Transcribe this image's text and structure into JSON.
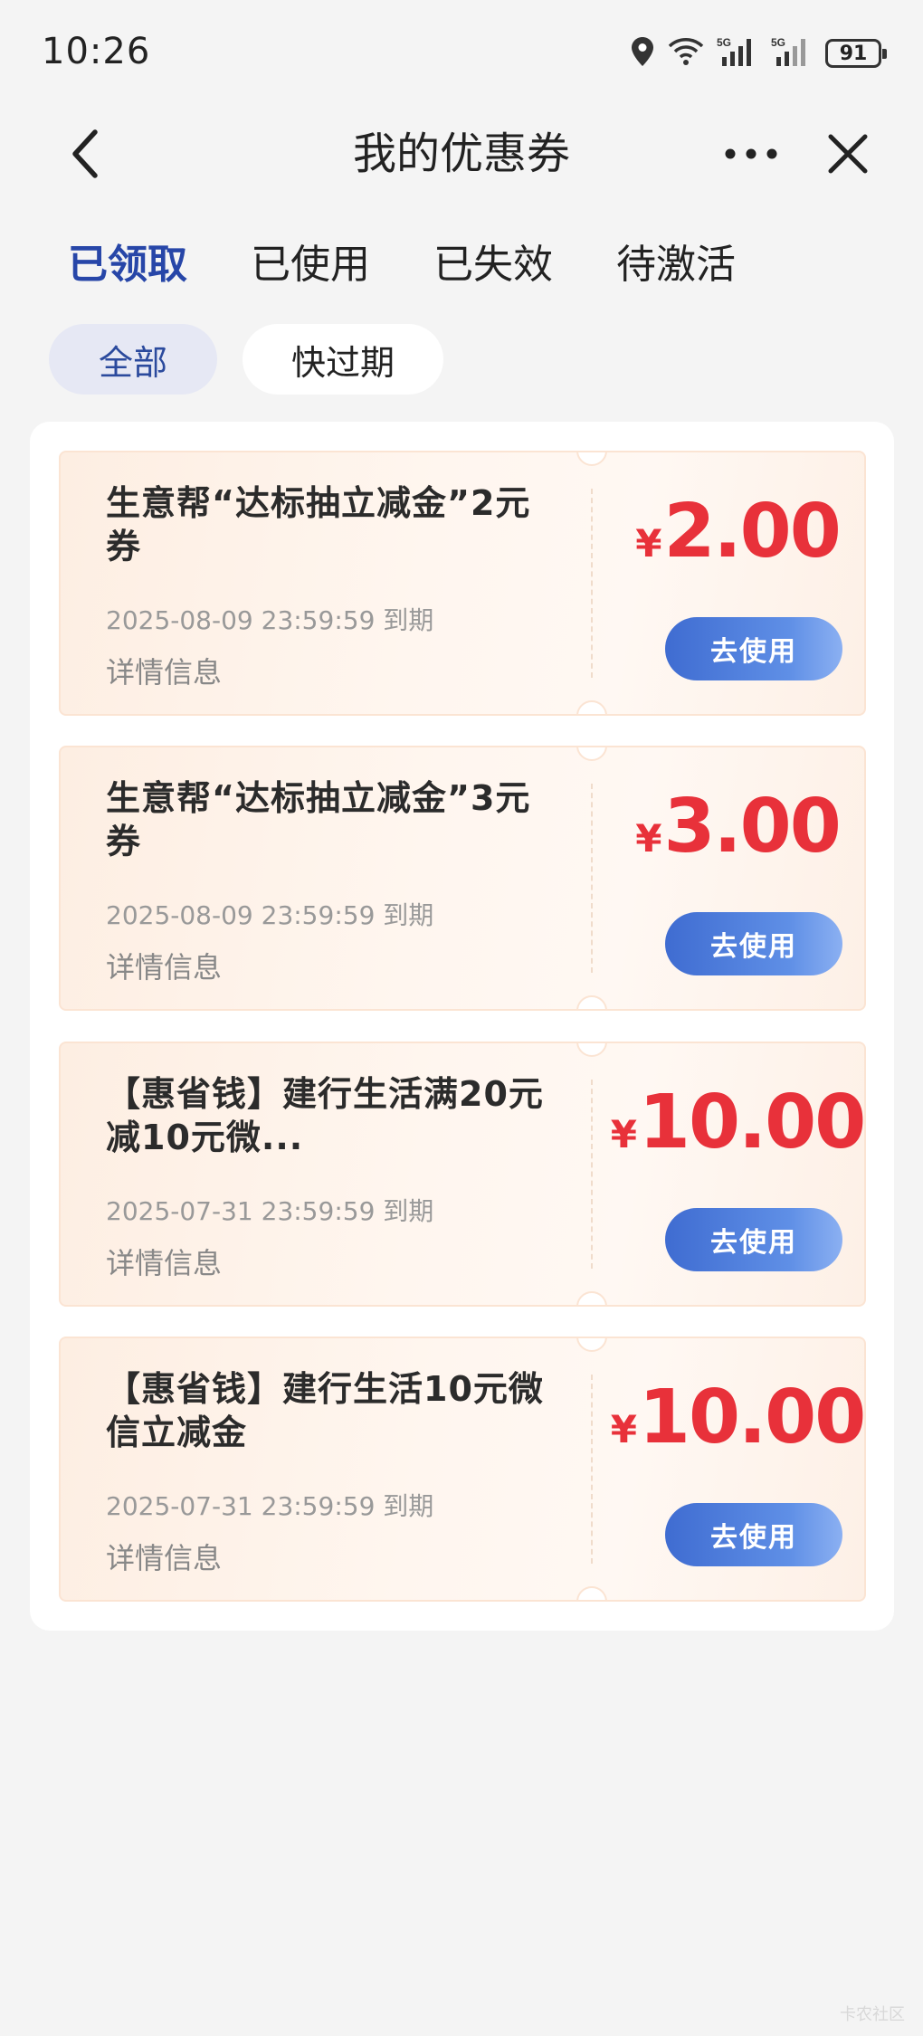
{
  "status": {
    "time": "10:26",
    "battery": "91",
    "network_left": "5G",
    "network_right": "5G"
  },
  "nav": {
    "title": "我的优惠券"
  },
  "tabs": [
    {
      "label": "已领取",
      "active": true
    },
    {
      "label": "已使用",
      "active": false
    },
    {
      "label": "已失效",
      "active": false
    },
    {
      "label": "待激活",
      "active": false
    }
  ],
  "filters": [
    {
      "label": "全部",
      "active": true
    },
    {
      "label": "快过期",
      "active": false
    }
  ],
  "coupons": [
    {
      "title": "生意帮“达标抽立减金”2元券",
      "expire": "2025-08-09 23:59:59 到期",
      "detail": "详情信息",
      "currency": "¥",
      "amount": "2.00",
      "button": "去使用"
    },
    {
      "title": "生意帮“达标抽立减金”3元券",
      "expire": "2025-08-09 23:59:59 到期",
      "detail": "详情信息",
      "currency": "¥",
      "amount": "3.00",
      "button": "去使用"
    },
    {
      "title": "【惠省钱】建行生活满20元减10元微...",
      "expire": "2025-07-31 23:59:59 到期",
      "detail": "详情信息",
      "currency": "¥",
      "amount": "10.00",
      "button": "去使用"
    },
    {
      "title": "【惠省钱】建行生活10元微信立减金",
      "expire": "2025-07-31 23:59:59 到期",
      "detail": "详情信息",
      "currency": "¥",
      "amount": "10.00",
      "button": "去使用"
    }
  ],
  "colors": {
    "accent": "#2746a8",
    "amount": "#e8313a",
    "button": "#4a78da"
  },
  "watermark": "卡农社区"
}
